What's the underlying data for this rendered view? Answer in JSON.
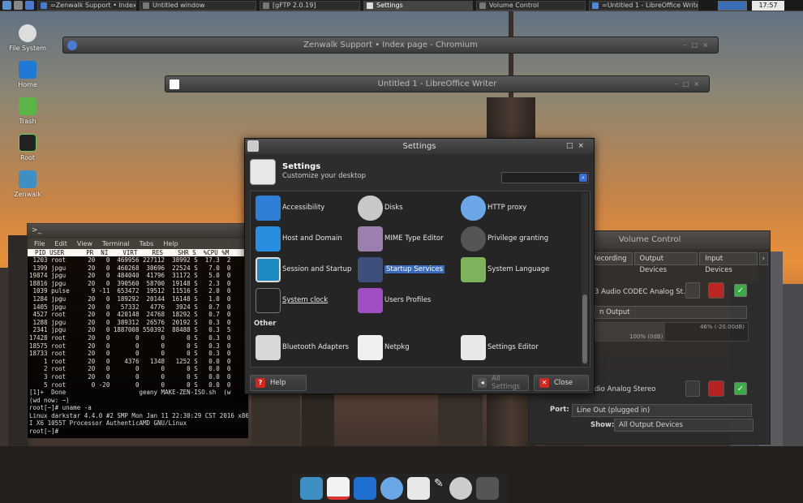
{
  "taskbar": {
    "tasks": [
      {
        "label": "=Zenwalk Support • Index pa..."
      },
      {
        "label": "Untitled window"
      },
      {
        "label": "[gFTP 2.0.19]"
      },
      {
        "label": "Settings"
      },
      {
        "label": "Volume Control"
      },
      {
        "label": "=Untitled 1 - LibreOffice Writer="
      }
    ],
    "clock": "17:57"
  },
  "desktop": {
    "icons": [
      {
        "label": "File System"
      },
      {
        "label": "Home"
      },
      {
        "label": "Trash"
      },
      {
        "label": "Root"
      },
      {
        "label": "Zenwalk"
      }
    ]
  },
  "windows": {
    "chromium": {
      "title": "Zenwalk Support • Index page - Chromium"
    },
    "writer": {
      "title": "Untitled 1 - LibreOffice Writer"
    }
  },
  "terminal": {
    "title": ">_",
    "menu": [
      "File",
      "Edit",
      "View",
      "Terminal",
      "Tabs",
      "Help"
    ],
    "header": "  PID USER      PR  NI    VIRT    RES    SHR S  %CPU %M",
    "lines": [
      " 1203 root      20   0  469956 227112  38992 S  17.3  2",
      " 1399 jpgu      20   0  460268  30696  22524 S   7.0  0",
      "19874 jpgu      20   0  484040  41796  31172 S   5.0  0",
      "18816 jpgu      20   0  390560  58700  19148 S   2.3  0",
      " 1039 pulse      9 -11  653472  19512  11516 S   2.0  0",
      " 1284 jpgu      20   0  189292  20144  16148 S   1.0  0",
      " 1405 jpgu      20   0   57332   4776   3924 S   0.7  0",
      " 4527 root      20   0  420148  24768  18292 S   0.7  0",
      " 1288 jpgu      20   0  389312  26576  20192 S   0.3  0",
      " 2341 jpgu      20   0 1887008 550392  88488 S   0.3  5",
      "17428 root      20   0       0      0      0 S   0.3  0",
      "18575 root      20   0       0      0      0 S   0.3  0",
      "18733 root      20   0       0      0      0 S   0.3  0",
      "    1 root      20   0    4376   1348   1252 S   0.0  0",
      "    2 root      20   0       0      0      0 S   0.0  0",
      "    3 root      20   0       0      0      0 S   0.0  0",
      "    5 root       0 -20       0      0      0 S   0.0  0",
      "[1]+  Done                    geany MAKE-ZEN-ISO.sh  (w",
      "(wd now: ~)",
      "root[~]# uname -a",
      "Linux darkstar 4.4.0 #2 SMP Mon Jan 11 22:30:29 CST 2016 x86_64 AMD Phenom(tm) I",
      "I X6 1055T Processor AuthenticAMD GNU/Linux",
      "root[~]#"
    ]
  },
  "volume": {
    "title": "Volume Control",
    "tabs": [
      "Recording",
      "Output Devices",
      "Input Devices"
    ],
    "device1": "3 Audio CODEC Analog St...",
    "port1": "n Output",
    "level_pct": "46% (-20.00dB)",
    "level_100": "100% (0dB)",
    "level_fraction": 0.46,
    "device2": "dio Analog Stereo",
    "port_label": "Port:",
    "port_value": "Line Out (plugged in)",
    "show_label": "Show:",
    "show_value": "All Output Devices"
  },
  "settings": {
    "window_title": "Settings",
    "header_title": "Settings",
    "header_subtitle": "Customize your desktop",
    "items": [
      {
        "label": "Accessibility"
      },
      {
        "label": "Disks"
      },
      {
        "label": "HTTP proxy"
      },
      {
        "label": "Host and Domain"
      },
      {
        "label": "MIME Type Editor"
      },
      {
        "label": "Privilege granting"
      },
      {
        "label": "Session and Startup"
      },
      {
        "label": "Startup Services"
      },
      {
        "label": "System Language"
      },
      {
        "label": "System clock"
      },
      {
        "label": "Users Profiles"
      }
    ],
    "other_title": "Other",
    "other_items": [
      {
        "label": "Bluetooth Adapters"
      },
      {
        "label": "Netpkg"
      },
      {
        "label": "Settings Editor"
      }
    ],
    "buttons": {
      "help": "Help",
      "all_settings": "All Settings",
      "close": "Close"
    }
  },
  "colors": {
    "selection": "#3a6bbf",
    "accent_blue": "#3b6fd1",
    "close_red": "#d2261f"
  }
}
